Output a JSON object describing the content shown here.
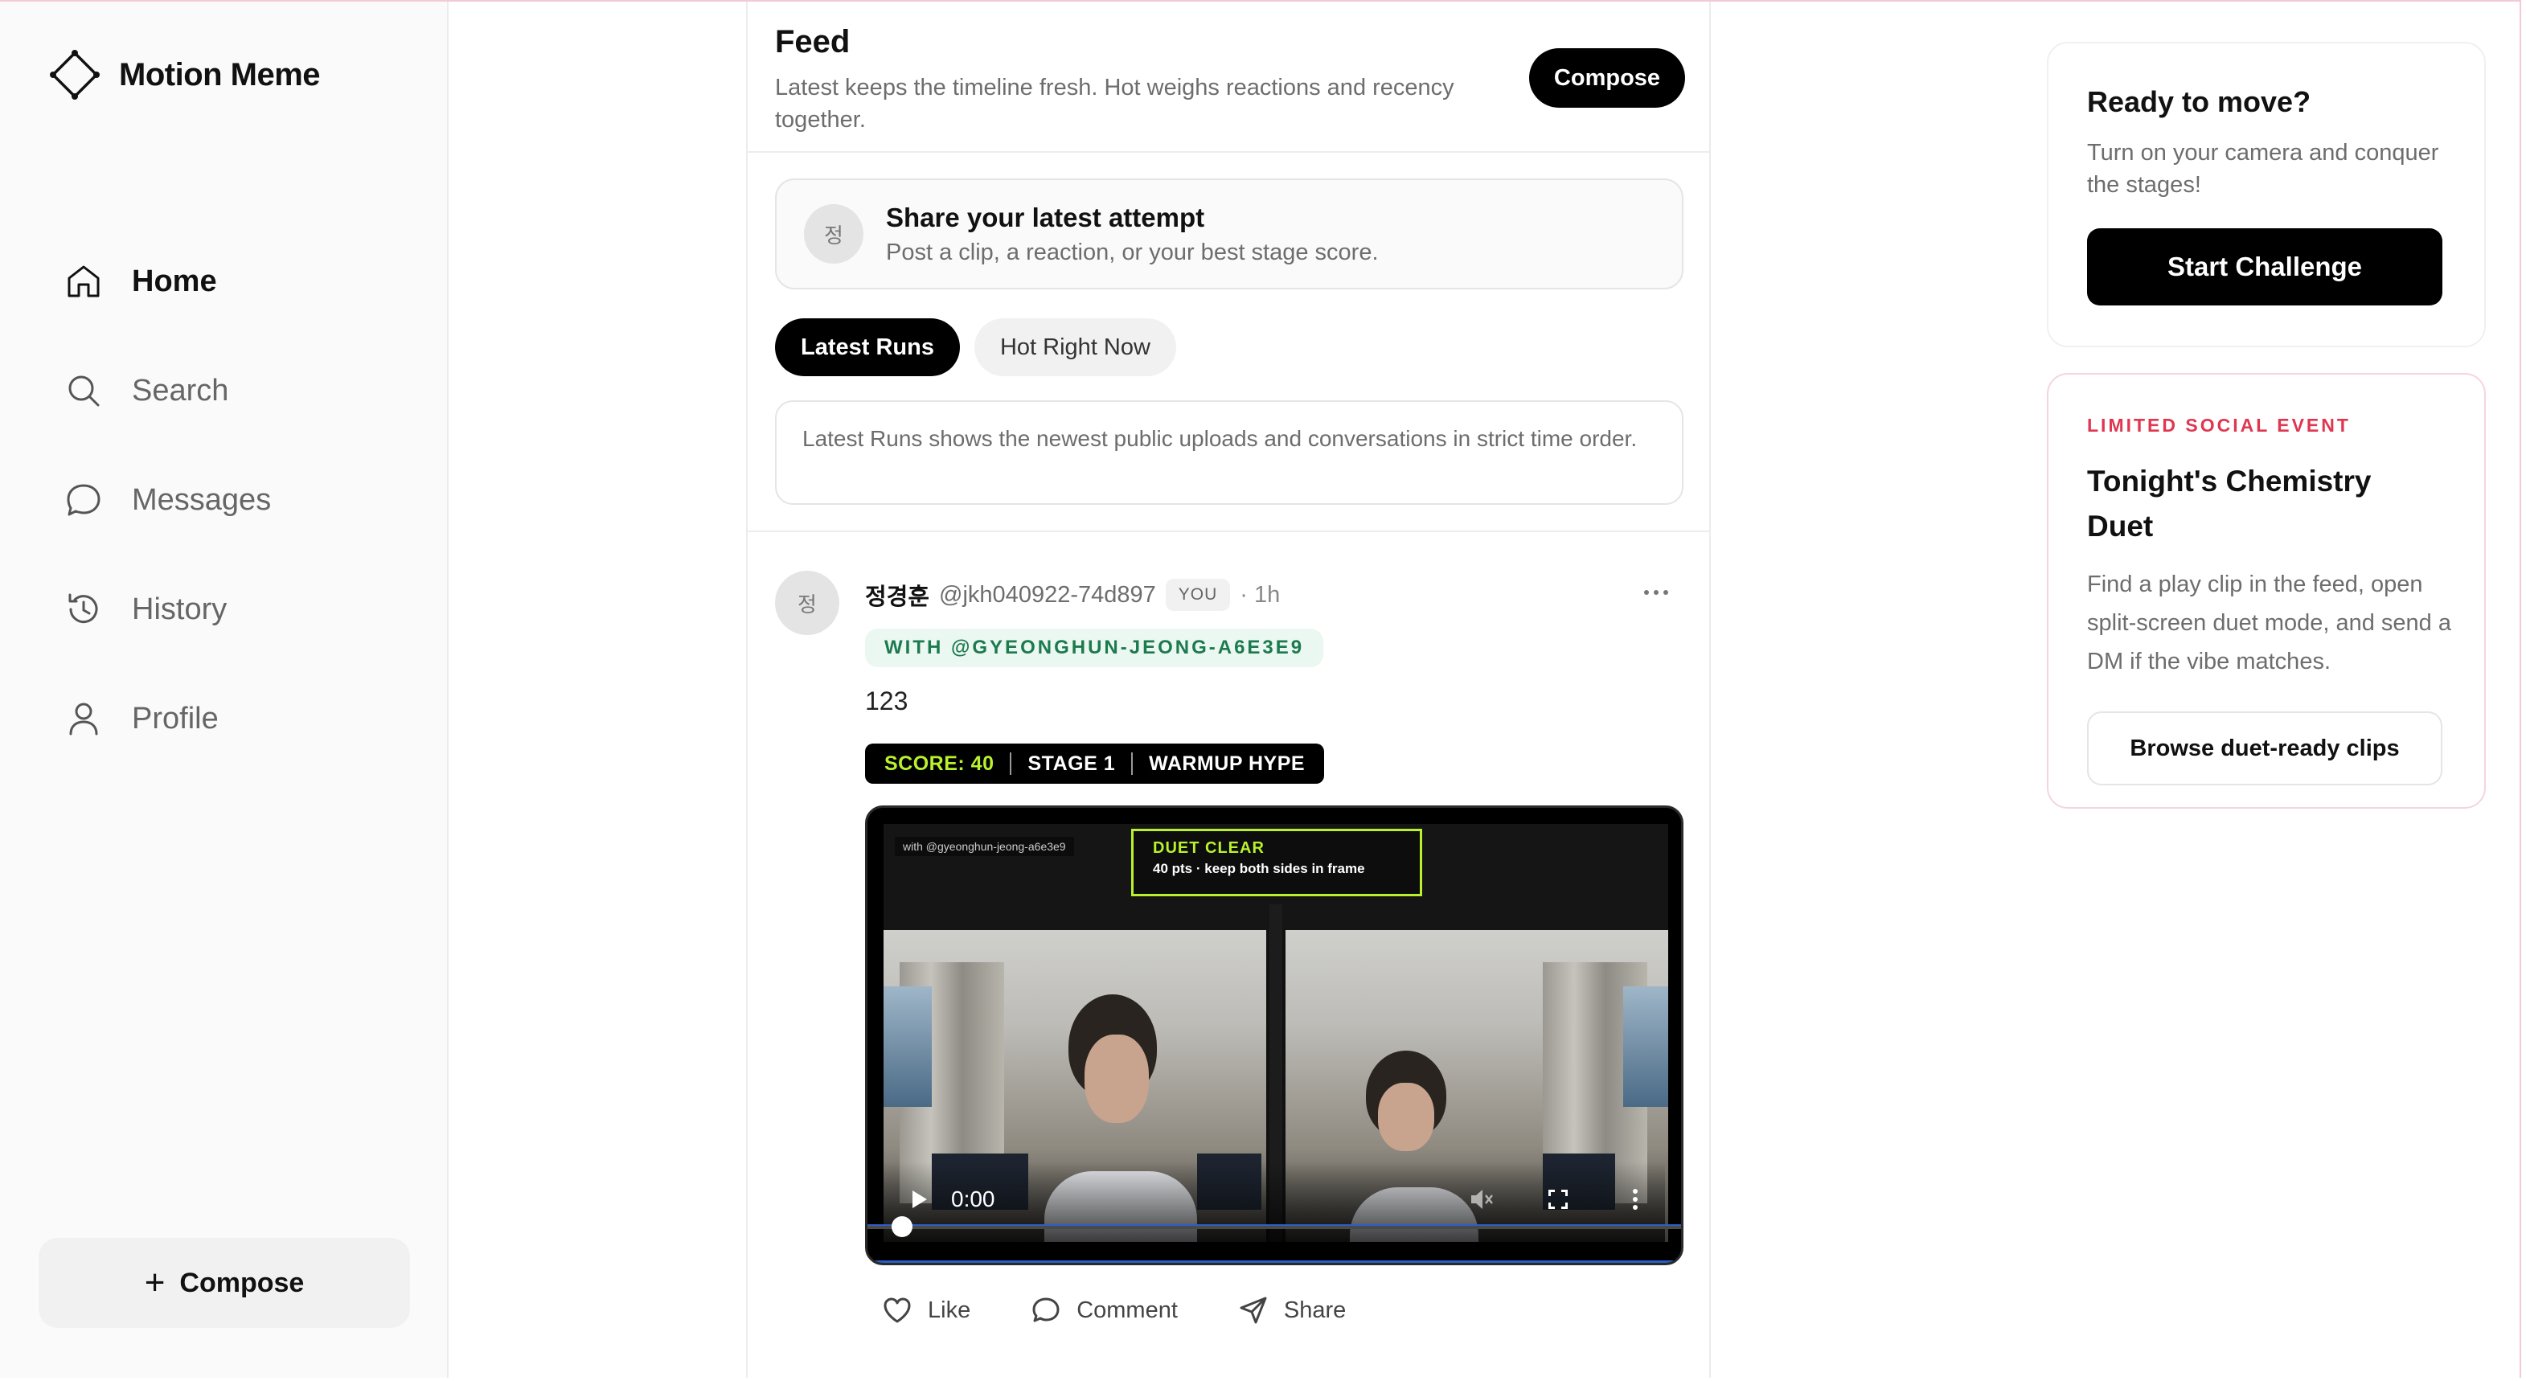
{
  "brand": {
    "name": "Motion Meme"
  },
  "sidebar": {
    "items": [
      {
        "label": "Home",
        "icon": "home-icon",
        "active": true
      },
      {
        "label": "Search",
        "icon": "search-icon"
      },
      {
        "label": "Messages",
        "icon": "message-icon"
      },
      {
        "label": "History",
        "icon": "history-icon"
      },
      {
        "label": "Profile",
        "icon": "user-icon"
      }
    ],
    "compose_label": "Compose"
  },
  "feed": {
    "title": "Feed",
    "subtitle": "Latest keeps the timeline fresh. Hot weighs reactions and recency together.",
    "compose_label": "Compose",
    "share": {
      "avatar": "정",
      "title": "Share your latest attempt",
      "subtitle": "Post a clip, a reaction, or your best stage score."
    },
    "tabs": [
      {
        "label": "Latest Runs",
        "active": true
      },
      {
        "label": "Hot Right Now",
        "active": false
      }
    ],
    "info": "Latest Runs shows the newest public uploads and conversations in strict time order."
  },
  "post": {
    "avatar": "정",
    "name": "정경훈",
    "handle": "@jkh040922-74d897",
    "badge": "YOU",
    "time": "· 1h",
    "with": "WITH @GYEONGHUN-JEONG-A6E3E9",
    "text": "123",
    "score": "SCORE: 40",
    "stage": "STAGE 1",
    "mode": "WARMUP HYPE",
    "video": {
      "with_label": "with @gyeonghun-jeong-a6e3e9",
      "duet_title": "DUET CLEAR",
      "duet_sub": "40 pts · keep both sides in frame",
      "time": "0:00",
      "progress": 0
    },
    "actions": {
      "like": "Like",
      "comment": "Comment",
      "share": "Share"
    }
  },
  "right": {
    "ready": {
      "title": "Ready to move?",
      "text": "Turn on your camera and conquer the stages!",
      "button": "Start Challenge"
    },
    "event": {
      "tag": "LIMITED SOCIAL EVENT",
      "title": "Tonight's Chemistry Duet",
      "text": "Find a play clip in the feed, open split-screen duet mode, and send a DM if the vibe matches.",
      "button": "Browse duet-ready clips"
    }
  },
  "colors": {
    "accent_green": "#b9f22c",
    "event_red": "#e0364f",
    "with_green": "#1c7a4e"
  }
}
